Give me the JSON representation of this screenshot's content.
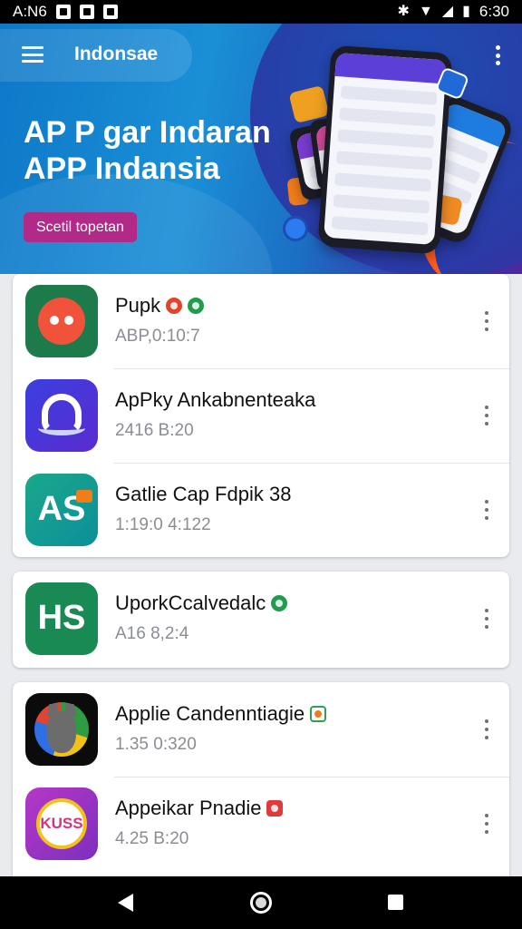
{
  "status_bar": {
    "left_text": "A:N6",
    "time": "6:30",
    "icons": [
      "image-icon",
      "notification-icon",
      "notification-icon",
      "alarm-icon",
      "wifi-icon",
      "signal-icon",
      "battery-icon"
    ]
  },
  "header": {
    "title": "Indonsae",
    "menu_icon": "hamburger-menu-icon",
    "overflow_icon": "more-vert-icon"
  },
  "hero": {
    "headline_line1": "AP P gar Indaran",
    "headline_line2": "APP Indansia",
    "cta_label": "Scetil topetan",
    "colors": {
      "gradient_start": "#0e78c8",
      "gradient_end": "#4b2a9c",
      "cta": "#b22a87",
      "accent": "#ff5a1f"
    }
  },
  "cards": [
    {
      "apps": [
        {
          "name": "Pupk",
          "meta": "ABP,0:10:7",
          "icon": "red-face-app-icon",
          "badges": [
            "red-circle-badge",
            "green-check-badge"
          ]
        },
        {
          "name": "ApPky Ankabnenteaka",
          "meta": "2416 B:20",
          "icon": "blue-arch-app-icon",
          "badges": []
        },
        {
          "name": "Gatlie Cap Fdpik 38",
          "meta": "1:19:0 4:122",
          "icon": "teal-as-app-icon",
          "badges": []
        }
      ]
    },
    {
      "apps": [
        {
          "name": "UporkCcalvedalc",
          "meta": "A16 8,2:4",
          "icon": "green-hs-app-icon",
          "badges": [
            "green-circle-badge"
          ]
        }
      ]
    },
    {
      "apps": [
        {
          "name": "Applie Candenntiagie",
          "meta": "1.35 0:320",
          "icon": "wolf-app-icon",
          "badges": [
            "green-square-badge"
          ]
        },
        {
          "name": "Appeikar Pnadie",
          "meta": "4.25 B:20",
          "icon": "kuss-app-icon",
          "badges": [
            "red-square-badge"
          ]
        }
      ]
    }
  ],
  "icon_text": {
    "as": "AS",
    "hs": "HS",
    "kuss": "KUSS"
  },
  "nav_bar": {
    "back_icon": "back-triangle-icon",
    "home_icon": "home-circle-icon",
    "recents_icon": "recents-square-icon"
  }
}
